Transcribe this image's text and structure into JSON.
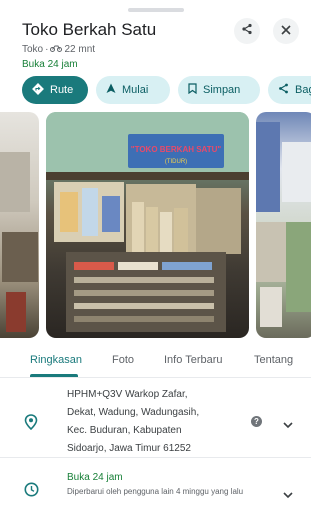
{
  "place": {
    "name": "Toko Berkah Satu",
    "category": "Toko",
    "travel_time": "22 mnt",
    "hours_status": "Buka 24 jam"
  },
  "header": {
    "share_icon": "share-icon",
    "close_icon": "close-icon"
  },
  "actions": [
    {
      "label": "Rute",
      "icon": "directions-icon"
    },
    {
      "label": "Mulai",
      "icon": "navigation-arrow-icon"
    },
    {
      "label": "Simpan",
      "icon": "bookmark-icon"
    },
    {
      "label": "Bagikan",
      "icon": "share-icon"
    }
  ],
  "photos": {
    "main_sign_text_line1": "\"TOKO BERKAH SATU\"",
    "main_sign_text_line2": "(TIDUR)"
  },
  "tabs": [
    {
      "label": "Ringkasan",
      "active": true
    },
    {
      "label": "Foto",
      "active": false
    },
    {
      "label": "Info Terbaru",
      "active": false
    },
    {
      "label": "Tentang",
      "active": false
    }
  ],
  "address": {
    "lines": [
      "HPHM+Q3V Warkop Zafar,",
      "Dekat, Wadung, Wadungasih,",
      "Kec. Buduran, Kabupaten",
      "Sidoarjo, Jawa Timur 61252"
    ]
  },
  "hours": {
    "title": "Buka 24 jam",
    "note": "Diperbarui oleh pengguna lain 4 minggu yang lalu"
  },
  "colors": {
    "accent": "#1a7a7c",
    "chip_bg": "#d8f0f3",
    "open_green": "#188038"
  }
}
